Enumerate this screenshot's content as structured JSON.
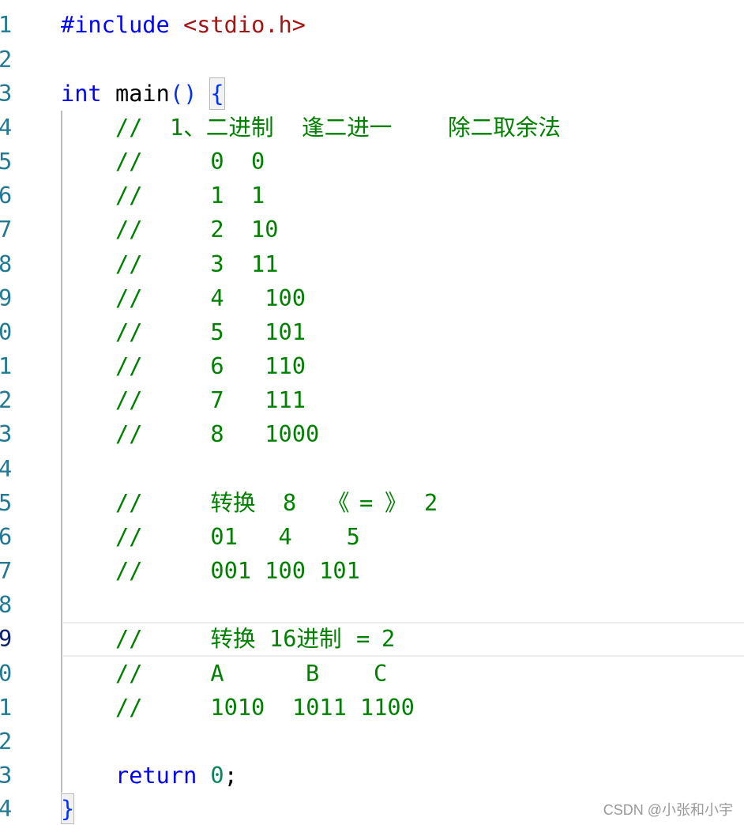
{
  "editor": {
    "line_numbers": [
      "1",
      "2",
      "3",
      "4",
      "5",
      "6",
      "7",
      "8",
      "9",
      "0",
      "1",
      "2",
      "3",
      "4",
      "5",
      "6",
      "7",
      "8",
      "9",
      "0",
      "1",
      "2",
      "3",
      "4"
    ],
    "lines": [
      [
        "#include",
        "<stdio.h>"
      ],
      [],
      [
        "int",
        "main",
        "()",
        "{"
      ],
      [
        "//",
        "1、二进制",
        "逢二进一",
        "除二取余法"
      ],
      [
        "//",
        "0",
        "0"
      ],
      [
        "//",
        "1",
        "1"
      ],
      [
        "//",
        "2",
        "10"
      ],
      [
        "//",
        "3",
        "11"
      ],
      [
        "//",
        "4",
        "100"
      ],
      [
        "//",
        "5",
        "101"
      ],
      [
        "//",
        "6",
        "110"
      ],
      [
        "//",
        "7",
        "111"
      ],
      [
        "//",
        "8",
        "1000"
      ],
      [],
      [
        "//",
        "转换",
        "8",
        "《",
        "=",
        "》",
        "2"
      ],
      [
        "//",
        "01",
        "4",
        "5"
      ],
      [
        "//",
        "001",
        "100",
        "101"
      ],
      [],
      [
        "//",
        "转换",
        "16进制",
        "=",
        "2"
      ],
      [
        "//",
        "A",
        "B",
        "C"
      ],
      [
        "//",
        "1010",
        "1011",
        "1100"
      ],
      [],
      [
        "return",
        "0",
        ";"
      ],
      [
        "}"
      ]
    ]
  },
  "watermark": "CSDN @小张和小宇",
  "colors": {
    "keyword": "#0000ff",
    "include_header": "#a31515",
    "comment": "#008000",
    "number": "#098658",
    "bracket": "#0431fa",
    "line_number": "#237893",
    "active_line_number": "#0b216f",
    "watermark": "#999999"
  }
}
